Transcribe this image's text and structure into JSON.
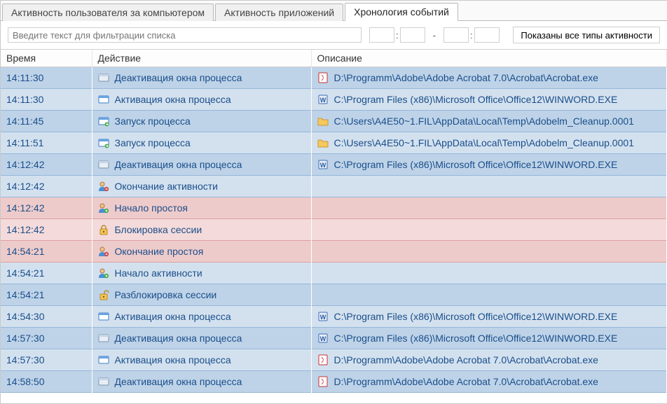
{
  "tabs": {
    "t0": "Активность пользователя за компьютером",
    "t1": "Активность приложений",
    "t2": "Хронология событий",
    "active_index": 2
  },
  "filter": {
    "placeholder": "Введите текст для фильтрации списка",
    "time_sep": ":",
    "dash": "-",
    "type_button": "Показаны все типы активности"
  },
  "columns": {
    "time": "Время",
    "action": "Действие",
    "description": "Описание"
  },
  "icons": {
    "window_dim": "window-inactive-icon",
    "window_active": "window-active-icon",
    "process_start": "process-start-icon",
    "user_end": "user-end-icon",
    "user_start": "user-start-icon",
    "lock": "lock-icon",
    "unlock": "unlock-icon",
    "pdf": "pdf-icon",
    "word": "word-icon",
    "folder": "folder-icon"
  },
  "rows": [
    {
      "time": "14:11:30",
      "action_icon": "window_dim",
      "action": "Деактивация окна процесса",
      "desc_icon": "pdf",
      "description": "D:\\Programm\\Adobe\\Adobe Acrobat 7.0\\Acrobat\\Acrobat.exe",
      "row": "blue-a"
    },
    {
      "time": "14:11:30",
      "action_icon": "window_active",
      "action": "Активация окна процесса",
      "desc_icon": "word",
      "description": "C:\\Program Files (x86)\\Microsoft Office\\Office12\\WINWORD.EXE",
      "row": "blue-b"
    },
    {
      "time": "14:11:45",
      "action_icon": "process_start",
      "action": "Запуск процесса",
      "desc_icon": "folder",
      "description": "C:\\Users\\A4E50~1.FIL\\AppData\\Local\\Temp\\Adobelm_Cleanup.0001",
      "row": "blue-a"
    },
    {
      "time": "14:11:51",
      "action_icon": "process_start",
      "action": "Запуск процесса",
      "desc_icon": "folder",
      "description": "C:\\Users\\A4E50~1.FIL\\AppData\\Local\\Temp\\Adobelm_Cleanup.0001",
      "row": "blue-b"
    },
    {
      "time": "14:12:42",
      "action_icon": "window_dim",
      "action": "Деактивация окна процесса",
      "desc_icon": "word",
      "description": "C:\\Program Files (x86)\\Microsoft Office\\Office12\\WINWORD.EXE",
      "row": "blue-a"
    },
    {
      "time": "14:12:42",
      "action_icon": "user_end",
      "action": "Окончание активности",
      "desc_icon": "",
      "description": "",
      "row": "blue-b"
    },
    {
      "time": "14:12:42",
      "action_icon": "user_start",
      "action": "Начало простоя",
      "desc_icon": "",
      "description": "",
      "row": "pink-a"
    },
    {
      "time": "14:12:42",
      "action_icon": "lock",
      "action": "Блокировка сессии",
      "desc_icon": "",
      "description": "",
      "row": "pink-b"
    },
    {
      "time": "14:54:21",
      "action_icon": "user_end",
      "action": "Окончание простоя",
      "desc_icon": "",
      "description": "",
      "row": "pink-a"
    },
    {
      "time": "14:54:21",
      "action_icon": "user_start",
      "action": "Начало активности",
      "desc_icon": "",
      "description": "",
      "row": "blue-b"
    },
    {
      "time": "14:54:21",
      "action_icon": "unlock",
      "action": "Разблокировка сессии",
      "desc_icon": "",
      "description": "",
      "row": "blue-a"
    },
    {
      "time": "14:54:30",
      "action_icon": "window_active",
      "action": "Активация окна процесса",
      "desc_icon": "word",
      "description": "C:\\Program Files (x86)\\Microsoft Office\\Office12\\WINWORD.EXE",
      "row": "blue-b"
    },
    {
      "time": "14:57:30",
      "action_icon": "window_dim",
      "action": "Деактивация окна процесса",
      "desc_icon": "word",
      "description": "C:\\Program Files (x86)\\Microsoft Office\\Office12\\WINWORD.EXE",
      "row": "blue-a"
    },
    {
      "time": "14:57:30",
      "action_icon": "window_active",
      "action": "Активация окна процесса",
      "desc_icon": "pdf",
      "description": "D:\\Programm\\Adobe\\Adobe Acrobat 7.0\\Acrobat\\Acrobat.exe",
      "row": "blue-b"
    },
    {
      "time": "14:58:50",
      "action_icon": "window_dim",
      "action": "Деактивация окна процесса",
      "desc_icon": "pdf",
      "description": "D:\\Programm\\Adobe\\Adobe Acrobat 7.0\\Acrobat\\Acrobat.exe",
      "row": "blue-a"
    }
  ]
}
